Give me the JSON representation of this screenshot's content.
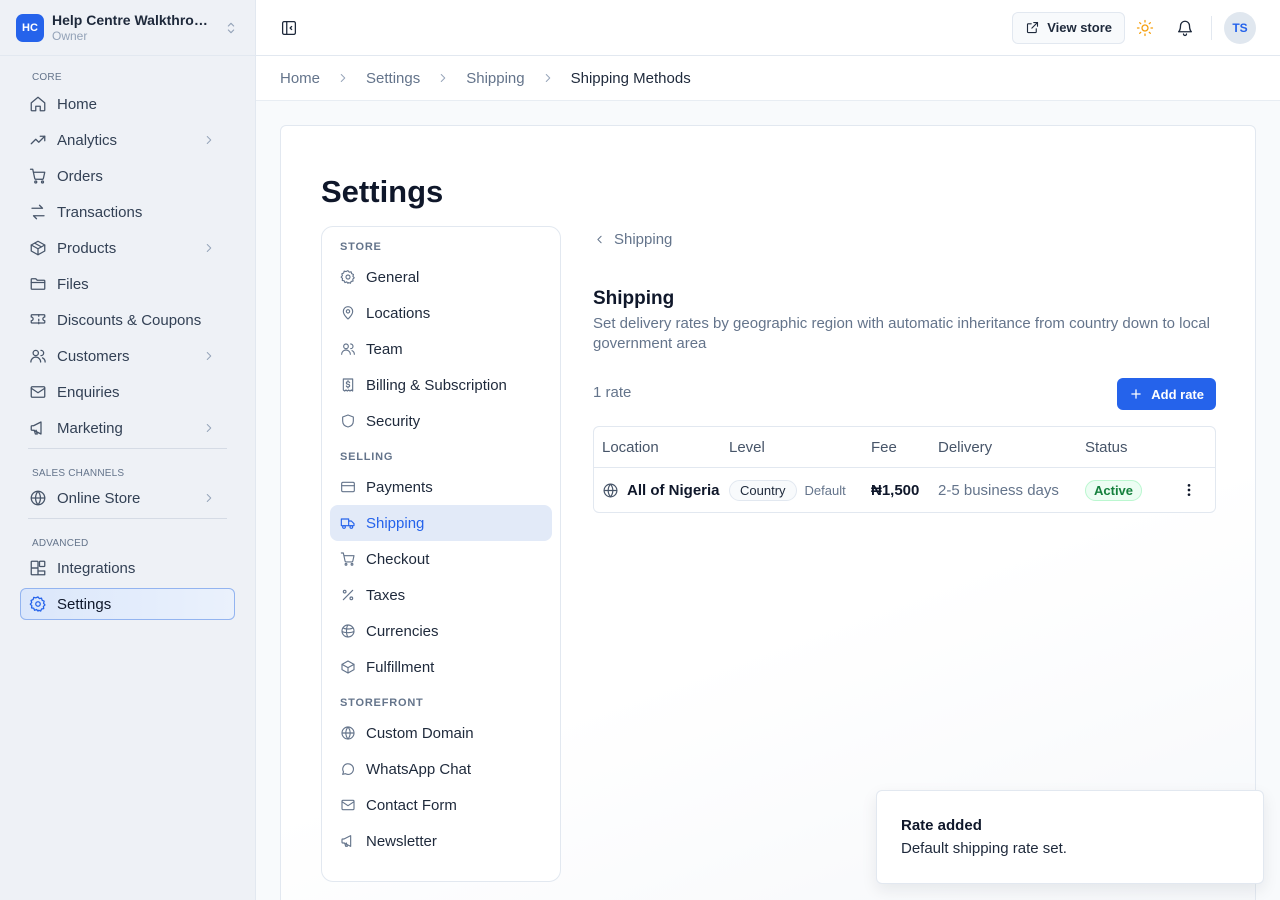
{
  "workspace": {
    "initials": "HC",
    "name": "Help Centre Walkthrough",
    "role": "Owner"
  },
  "sidebar": {
    "groups": [
      {
        "label": "CORE",
        "items": [
          {
            "label": "Home",
            "icon": "home-icon",
            "chevron": false
          },
          {
            "label": "Analytics",
            "icon": "trending-up-icon",
            "chevron": true
          },
          {
            "label": "Orders",
            "icon": "cart-icon",
            "chevron": false
          },
          {
            "label": "Transactions",
            "icon": "arrows-swap-icon",
            "chevron": false
          },
          {
            "label": "Products",
            "icon": "box-icon",
            "chevron": true
          },
          {
            "label": "Files",
            "icon": "folder-icon",
            "chevron": false
          },
          {
            "label": "Discounts & Coupons",
            "icon": "ticket-icon",
            "chevron": false
          },
          {
            "label": "Customers",
            "icon": "users-icon",
            "chevron": true
          },
          {
            "label": "Enquiries",
            "icon": "mail-icon",
            "chevron": false
          },
          {
            "label": "Marketing",
            "icon": "megaphone-icon",
            "chevron": true
          }
        ]
      },
      {
        "label": "SALES CHANNELS",
        "items": [
          {
            "label": "Online Store",
            "icon": "globe-icon",
            "chevron": true
          }
        ]
      },
      {
        "label": "ADVANCED",
        "items": [
          {
            "label": "Integrations",
            "icon": "blocks-icon",
            "chevron": false
          },
          {
            "label": "Settings",
            "icon": "gear-icon",
            "chevron": false,
            "active": true
          }
        ]
      }
    ]
  },
  "topbar": {
    "view_store": "View store",
    "avatar": "TS"
  },
  "breadcrumb": [
    "Home",
    "Settings",
    "Shipping",
    "Shipping Methods"
  ],
  "page": {
    "title": "Settings"
  },
  "settings_nav": [
    {
      "label": "STORE",
      "items": [
        {
          "label": "General",
          "icon": "gear-icon"
        },
        {
          "label": "Locations",
          "icon": "map-pin-icon"
        },
        {
          "label": "Team",
          "icon": "users-icon"
        },
        {
          "label": "Billing & Subscription",
          "icon": "receipt-icon"
        },
        {
          "label": "Security",
          "icon": "shield-icon"
        }
      ]
    },
    {
      "label": "SELLING",
      "items": [
        {
          "label": "Payments",
          "icon": "card-icon"
        },
        {
          "label": "Shipping",
          "icon": "truck-icon",
          "active": true
        },
        {
          "label": "Checkout",
          "icon": "cart-icon"
        },
        {
          "label": "Taxes",
          "icon": "percent-icon"
        },
        {
          "label": "Currencies",
          "icon": "coins-icon"
        },
        {
          "label": "Fulfillment",
          "icon": "package-icon"
        }
      ]
    },
    {
      "label": "STOREFRONT",
      "items": [
        {
          "label": "Custom Domain",
          "icon": "globe-icon"
        },
        {
          "label": "WhatsApp Chat",
          "icon": "chat-icon"
        },
        {
          "label": "Contact Form",
          "icon": "mail-icon"
        },
        {
          "label": "Newsletter",
          "icon": "megaphone-icon"
        }
      ]
    }
  ],
  "content": {
    "back_label": "Shipping",
    "title": "Shipping",
    "description": "Set delivery rates by geographic region with automatic inheritance from country down to local government area",
    "rate_count": "1 rate",
    "add_button": "Add rate",
    "table": {
      "headers": [
        "Location",
        "Level",
        "Fee",
        "Delivery",
        "Status"
      ],
      "rows": [
        {
          "location": "All of Nigeria",
          "level": "Country",
          "default": "Default",
          "fee": "₦1,500",
          "delivery": "2-5 business days",
          "status": "Active"
        }
      ]
    }
  },
  "toast": {
    "title": "Rate added",
    "description": "Default shipping rate set."
  },
  "colors": {
    "accent": "#2563eb",
    "success": "#15803d",
    "sun": "#f59e0b"
  }
}
